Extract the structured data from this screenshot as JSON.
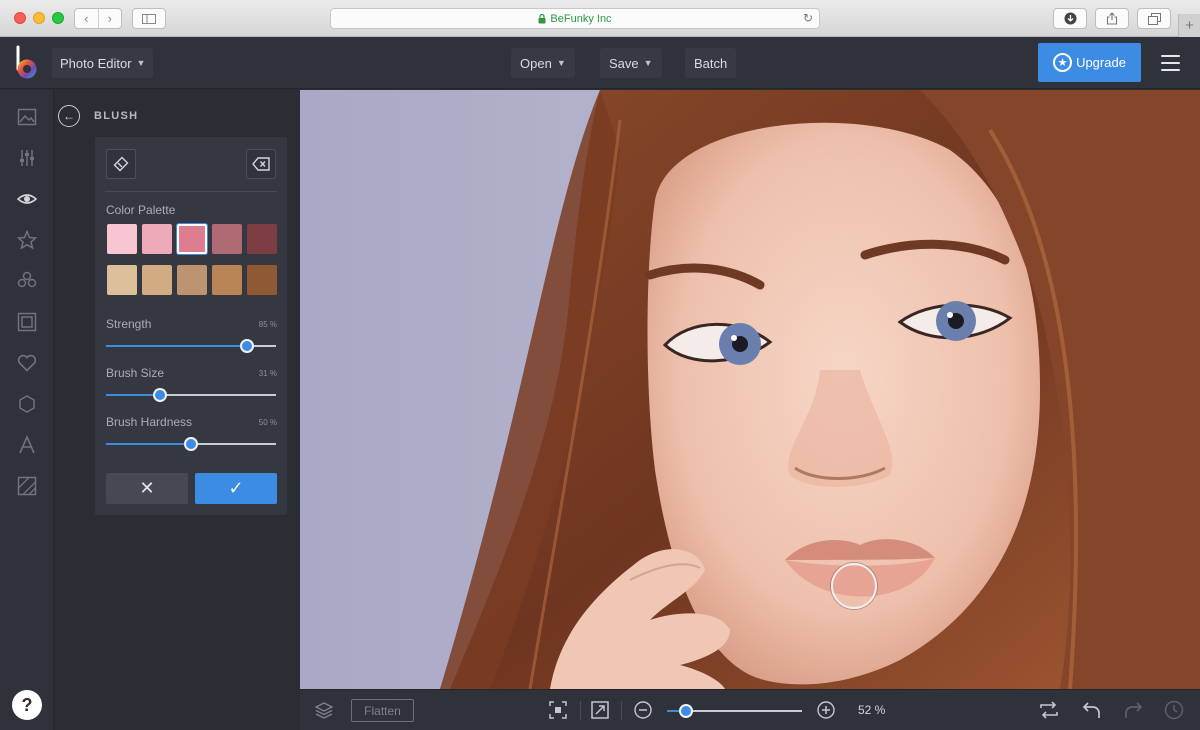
{
  "browser": {
    "address": "BeFunky Inc",
    "lock_icon": "lock-icon"
  },
  "topbar": {
    "app_menu": "Photo Editor",
    "open": "Open",
    "save": "Save",
    "batch": "Batch",
    "upgrade": "Upgrade",
    "accent": "#3d8ce4"
  },
  "rail": {
    "icons": [
      "image-icon",
      "sliders-icon",
      "eye-icon",
      "star-icon",
      "layers-icon",
      "frame-icon",
      "heart-icon",
      "shape-icon",
      "text-icon",
      "texture-icon"
    ],
    "active": "eye-icon",
    "help": "?"
  },
  "panel": {
    "title": "BLUSH",
    "palette_label": "Color Palette",
    "swatches_row1": [
      "#f7c6d2",
      "#eeaab8",
      "#dc7d90",
      "#b06a74",
      "#7c3e42"
    ],
    "swatches_row2": [
      "#dcbf98",
      "#d3ab82",
      "#bd9472",
      "#b98558",
      "#8f5a33"
    ],
    "selected_swatch": 2,
    "sliders": [
      {
        "label": "Strength",
        "value": "85 %",
        "fraction": 0.83
      },
      {
        "label": "Brush Size",
        "value": "31 %",
        "fraction": 0.32
      },
      {
        "label": "Brush Hardness",
        "value": "50 %",
        "fraction": 0.5
      }
    ],
    "cancel": "✕",
    "apply": "✓"
  },
  "bottombar": {
    "flatten": "Flatten",
    "zoom": "52 %",
    "zoom_fraction": 0.14
  }
}
